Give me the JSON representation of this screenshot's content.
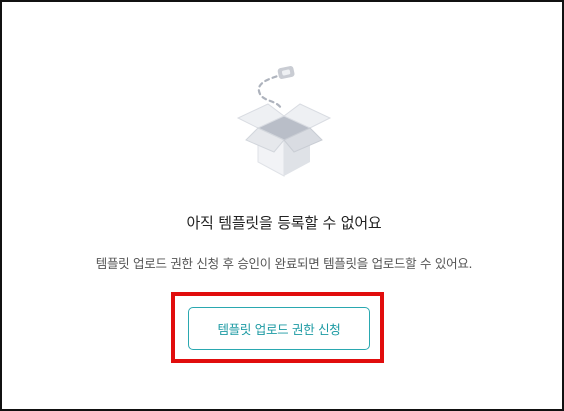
{
  "empty_state": {
    "illustration_icon": "open-box-icon",
    "title": "아직 템플릿을 등록할 수 없어요",
    "description": "템플릿 업로드 권한 신청 후 승인이 완료되면 템플릿을 업로드할 수 있어요.",
    "request_button_label": "템플릿 업로드 권한 신청"
  },
  "colors": {
    "accent": "#1c9aa3",
    "accent_border": "#2aa8b0",
    "highlight": "#e10d0d",
    "box_light": "#eef0f3",
    "box_mid": "#d9dce2",
    "box_dark": "#b9bec8"
  }
}
